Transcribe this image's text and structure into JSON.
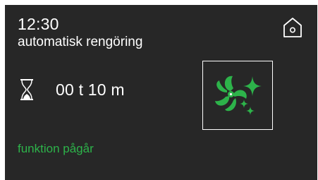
{
  "status_bar": {
    "time": "12:30",
    "home_icon": "home-icon"
  },
  "program": {
    "name": "automatisk rengöring",
    "icon": "fan-sparkle-icon"
  },
  "timer": {
    "icon": "hourglass-icon",
    "remaining": "00 t 10 m"
  },
  "status": {
    "text": "funktion pågår"
  },
  "colors": {
    "background": "#272727",
    "text": "#ffffff",
    "accent_green": "#2db34a"
  }
}
